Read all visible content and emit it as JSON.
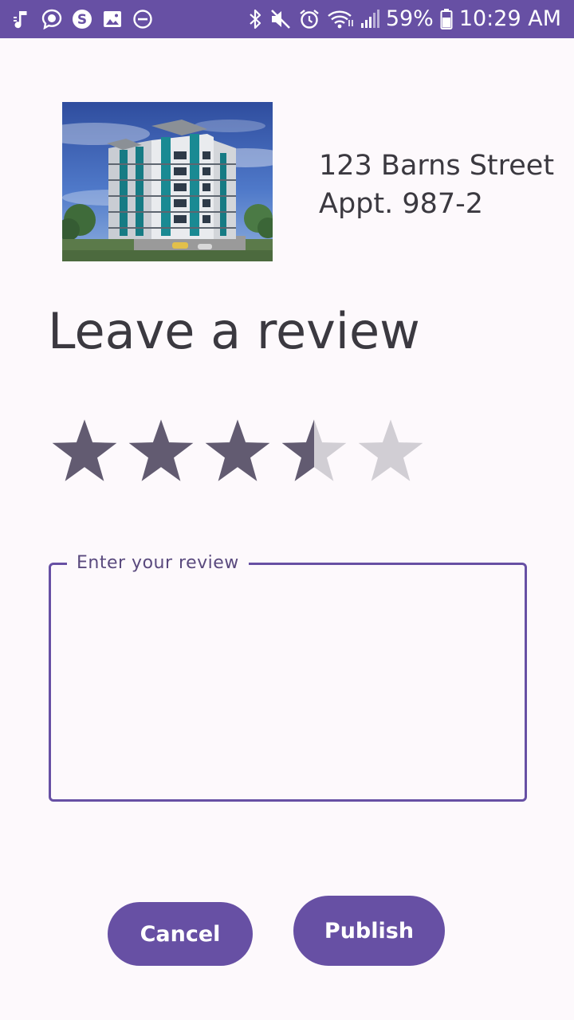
{
  "status_bar": {
    "battery": "59%",
    "time": "10:29 AM",
    "left_icons": [
      "music-note-icon",
      "chat-bubble-icon",
      "skype-icon",
      "image-icon",
      "do-not-disturb-icon"
    ],
    "right_icons": [
      "bluetooth-icon",
      "mute-icon",
      "alarm-icon",
      "wifi-icon",
      "signal-icon",
      "battery-icon"
    ]
  },
  "listing": {
    "address_line1": "123 Barns Street",
    "address_line2": "Appt. 987-2"
  },
  "review": {
    "title": "Leave a review",
    "rating": 3.5,
    "max_rating": 5,
    "input_label": "Enter your review",
    "input_value": ""
  },
  "actions": {
    "cancel_label": "Cancel",
    "publish_label": "Publish"
  },
  "colors": {
    "accent": "#6750a4",
    "star_filled": "#625b71",
    "star_empty": "#d1ced4",
    "text": "#3b3940",
    "background": "#fdf9fc"
  }
}
